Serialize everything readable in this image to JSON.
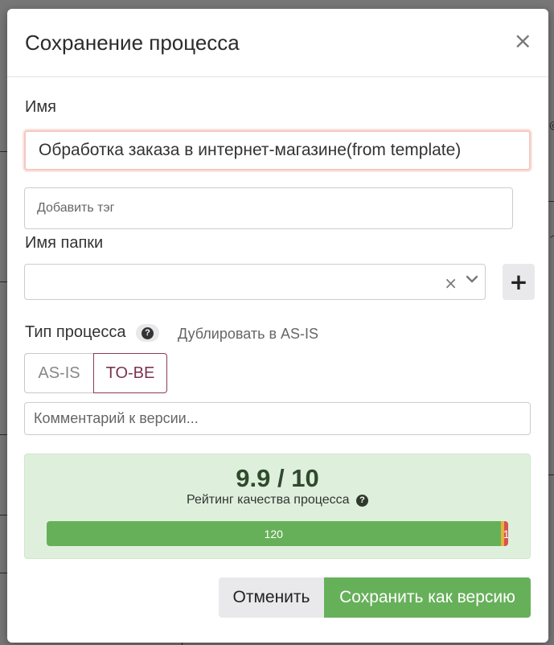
{
  "dialog": {
    "title": "Сохранение процесса",
    "close_symbol": "×"
  },
  "form": {
    "name_label": "Имя",
    "name_value": "Обработка заказа в интернет-магазине(from template)",
    "tag_placeholder": "Добавить тэг",
    "folder_label": "Имя папки",
    "folder_value": "",
    "folder_clear_symbol": "×",
    "add_folder_symbol": "+",
    "process_type_label": "Тип процесса",
    "help_symbol": "?",
    "duplicate_link": "Дублировать в AS-IS",
    "process_type_options": [
      "AS-IS",
      "TO-BE"
    ],
    "process_type_selected": "TO-BE",
    "comment_placeholder": "Комментарий к версии..."
  },
  "rating": {
    "score": "9.9 / 10",
    "label": "Рейтинг качества процесса",
    "help_symbol": "?",
    "bar": [
      {
        "label": "120",
        "value": 120,
        "color": "#67b05a"
      },
      {
        "label": "",
        "value": 1,
        "color": "#e3b43c"
      },
      {
        "label": "1",
        "value": 1,
        "color": "#d9534f"
      }
    ]
  },
  "footer": {
    "cancel_label": "Отменить",
    "save_label": "Сохранить как версию"
  },
  "icons": {
    "close": "close-icon",
    "clear": "clear-icon",
    "chevron": "chevron-down-icon",
    "plus": "plus-icon",
    "help": "question-circle-icon"
  },
  "colors": {
    "accent_green": "#67b05a",
    "rating_bg": "#def0dc",
    "tobe_border": "#8a3a5a"
  }
}
